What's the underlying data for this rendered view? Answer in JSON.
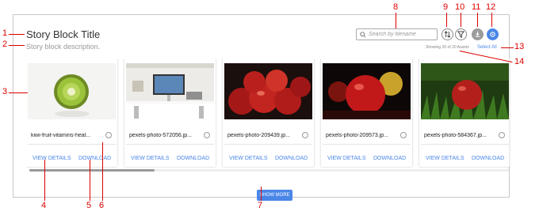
{
  "block": {
    "title": "Story Block Title",
    "description": "Story block description."
  },
  "toolbar": {
    "search_placeholder": "Search by filename",
    "sort_icon": "sort-arrows-icon",
    "filter_icon": "filter-icon",
    "download_icon": "download-icon",
    "settings_icon": "settings-icon",
    "showing_text": "Showing 20 of 20 Assets",
    "select_all_label": "Select All"
  },
  "cards": [
    {
      "filename": "kiwi-fruit-vitamins-heal...",
      "view_label": "VIEW DETAILS",
      "download_label": "DOWNLOAD"
    },
    {
      "filename": "pexels-photo-572056.jp...",
      "view_label": "VIEW DETAILS",
      "download_label": "DOWNLOAD"
    },
    {
      "filename": "pexels-photo-209439.jp...",
      "view_label": "VIEW DETAILS",
      "download_label": "DOWNLOAD"
    },
    {
      "filename": "pexels-photo-209573.jp...",
      "view_label": "VIEW DETAILS",
      "download_label": "DOWNLOAD"
    },
    {
      "filename": "pexels-photo-584367.jp...",
      "view_label": "VIEW DETAILS",
      "download_label": "DOWNLOAD"
    }
  ],
  "show_more_label": "SHOW MORE",
  "annotations": [
    "1",
    "2",
    "3",
    "4",
    "5",
    "6",
    "7",
    "8",
    "9",
    "10",
    "11",
    "12",
    "13",
    "14"
  ],
  "colors": {
    "accent": "#4a86e8",
    "annotation": "#dd0000"
  }
}
